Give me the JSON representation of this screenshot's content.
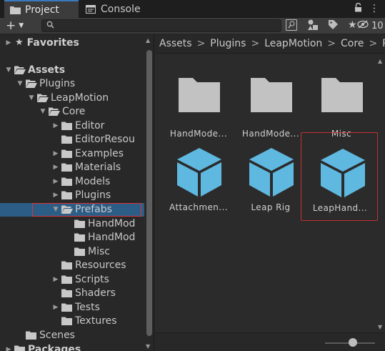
{
  "tabs": [
    {
      "label": "Project",
      "icon": "folder-icon",
      "active": true
    },
    {
      "label": "Console",
      "icon": "console-icon",
      "active": false
    }
  ],
  "toolbar": {
    "create_label": "+",
    "search_placeholder": "",
    "hidden_count": "10"
  },
  "tree": {
    "favorites": "Favorites",
    "rows": [
      {
        "label": "Assets",
        "section": true
      },
      {
        "label": "Plugins"
      },
      {
        "label": "LeapMotion"
      },
      {
        "label": "Core"
      },
      {
        "label": "Editor"
      },
      {
        "label": "EditorResou"
      },
      {
        "label": "Examples"
      },
      {
        "label": "Materials"
      },
      {
        "label": "Models"
      },
      {
        "label": "Plugins"
      },
      {
        "label": "Prefabs",
        "selected": true
      },
      {
        "label": "HandMod"
      },
      {
        "label": "HandMod"
      },
      {
        "label": "Misc"
      },
      {
        "label": "Resources"
      },
      {
        "label": "Scripts"
      },
      {
        "label": "Shaders"
      },
      {
        "label": "Tests"
      },
      {
        "label": "Textures"
      },
      {
        "label": "Scenes"
      },
      {
        "label": "Packages",
        "section": true
      }
    ]
  },
  "breadcrumb": [
    "Assets",
    "Plugins",
    "LeapMotion",
    "Core",
    "Pr"
  ],
  "assets": [
    {
      "label": "HandMode...",
      "kind": "folder"
    },
    {
      "label": "HandMode...",
      "kind": "folder"
    },
    {
      "label": "Misc",
      "kind": "folder"
    },
    {
      "label": "Attachmen...",
      "kind": "prefab"
    },
    {
      "label": "Leap Rig",
      "kind": "prefab"
    },
    {
      "label": "LeapHand...",
      "kind": "prefab",
      "selected": true
    }
  ],
  "zoom_level": 0.5,
  "colors": {
    "accent": "#3a79bb",
    "selection": "#2c5d87",
    "highlight": "#d9363a",
    "folder": "#c2c2c2",
    "prefab": "#5fb8e0"
  }
}
